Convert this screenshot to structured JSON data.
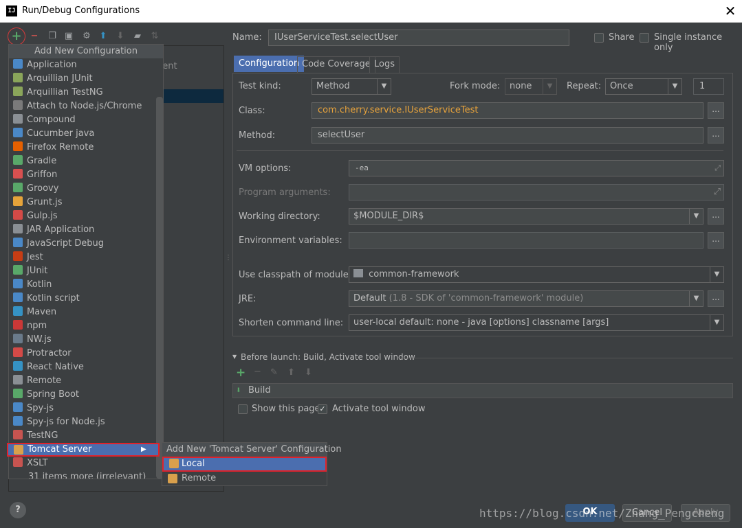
{
  "window": {
    "title": "Run/Debug Configurations",
    "app_icon_text": "IJ"
  },
  "left_panel": {
    "partial_text": "dent"
  },
  "popup": {
    "title": "Add New Configuration",
    "items": [
      {
        "label": "Application",
        "icon": "application-icon",
        "color": "#4a88c7"
      },
      {
        "label": "Arquillian JUnit",
        "icon": "arquillian-icon",
        "color": "#8aa55a"
      },
      {
        "label": "Arquillian TestNG",
        "icon": "arquillian-icon",
        "color": "#8aa55a"
      },
      {
        "label": "Attach to Node.js/Chrome",
        "icon": "node-attach-icon",
        "color": "#7a7a7a"
      },
      {
        "label": "Compound",
        "icon": "folder-icon",
        "color": "#8a8f94"
      },
      {
        "label": "Cucumber java",
        "icon": "cucumber-icon",
        "color": "#4a88c7"
      },
      {
        "label": "Firefox Remote",
        "icon": "firefox-icon",
        "color": "#e66000"
      },
      {
        "label": "Gradle",
        "icon": "gradle-icon",
        "color": "#59a869"
      },
      {
        "label": "Griffon",
        "icon": "griffon-icon",
        "color": "#d85050"
      },
      {
        "label": "Groovy",
        "icon": "groovy-icon",
        "color": "#59a869"
      },
      {
        "label": "Grunt.js",
        "icon": "grunt-icon",
        "color": "#e5a33a"
      },
      {
        "label": "Gulp.js",
        "icon": "gulp-icon",
        "color": "#d34a47"
      },
      {
        "label": "JAR Application",
        "icon": "jar-icon",
        "color": "#8a8f94"
      },
      {
        "label": "JavaScript Debug",
        "icon": "js-debug-icon",
        "color": "#4a88c7"
      },
      {
        "label": "Jest",
        "icon": "jest-icon",
        "color": "#c63d14"
      },
      {
        "label": "JUnit",
        "icon": "junit-icon",
        "color": "#59a869"
      },
      {
        "label": "Kotlin",
        "icon": "kotlin-icon",
        "color": "#4a88c7"
      },
      {
        "label": "Kotlin script",
        "icon": "kotlin-icon",
        "color": "#4a88c7"
      },
      {
        "label": "Maven",
        "icon": "gear-icon",
        "color": "#3592c4"
      },
      {
        "label": "npm",
        "icon": "npm-icon",
        "color": "#cb3837"
      },
      {
        "label": "NW.js",
        "icon": "nwjs-icon",
        "color": "#6a7a8a"
      },
      {
        "label": "Protractor",
        "icon": "protractor-icon",
        "color": "#d34a47"
      },
      {
        "label": "React Native",
        "icon": "react-icon",
        "color": "#3592c4"
      },
      {
        "label": "Remote",
        "icon": "remote-icon",
        "color": "#8a8f94"
      },
      {
        "label": "Spring Boot",
        "icon": "spring-icon",
        "color": "#59a869"
      },
      {
        "label": "Spy-js",
        "icon": "spy-js-icon",
        "color": "#4a88c7"
      },
      {
        "label": "Spy-js for Node.js",
        "icon": "spy-js-icon",
        "color": "#4a88c7"
      },
      {
        "label": "TestNG",
        "icon": "testng-icon",
        "color": "#c75450"
      },
      {
        "label": "Tomcat Server",
        "icon": "tomcat-icon",
        "color": "#d9a04c"
      },
      {
        "label": "XSLT",
        "icon": "xslt-icon",
        "color": "#c75450"
      },
      {
        "label": "31 items more (irrelevant)",
        "icon": "",
        "color": "#3c3f41"
      }
    ]
  },
  "submenu": {
    "title": "Add New 'Tomcat Server' Configuration",
    "local": "Local",
    "remote": "Remote"
  },
  "form": {
    "name_label": "Name:",
    "name_value": "IUserServiceTest.selectUser",
    "share_label": "Share",
    "single_instance_label": "Single instance only",
    "tabs": [
      "Configuration",
      "Code Coverage",
      "Logs"
    ],
    "test_kind_label": "Test kind:",
    "test_kind_value": "Method",
    "fork_mode_label": "Fork mode:",
    "fork_mode_value": "none",
    "repeat_label": "Repeat:",
    "repeat_value": "Once",
    "repeat_count": "1",
    "class_label": "Class:",
    "class_value": "com.cherry.service.IUserServiceTest",
    "method_label": "Method:",
    "method_value": "selectUser",
    "vm_options_label": "VM options:",
    "vm_options_value": "-ea",
    "program_args_label": "Program arguments:",
    "working_dir_label": "Working directory:",
    "working_dir_value": "$MODULE_DIR$",
    "env_vars_label": "Environment variables:",
    "classpath_label": "Use classpath of module:",
    "classpath_value": "common-framework",
    "jre_label": "JRE:",
    "jre_value": "Default",
    "jre_detail": "(1.8 - SDK of 'common-framework' module)",
    "shorten_label": "Shorten command line:",
    "shorten_value": "user-local default: none - java [options] classname [args]",
    "dots": "..."
  },
  "before_launch": {
    "header": "Before launch: Build, Activate tool window",
    "item": "Build",
    "show_page_label": "Show this page",
    "activate_label": "Activate tool window"
  },
  "footer": {
    "ok": "OK",
    "cancel": "Cancel",
    "apply": "Apply",
    "help": "?",
    "watermark": "https://blog.csdn.net/Zhang_Pengcheng"
  },
  "colors": {
    "accent": "#4b6eaf",
    "highlight_border": "#e0222b",
    "class_text": "#e6a23c",
    "bg": "#3c3f41"
  }
}
